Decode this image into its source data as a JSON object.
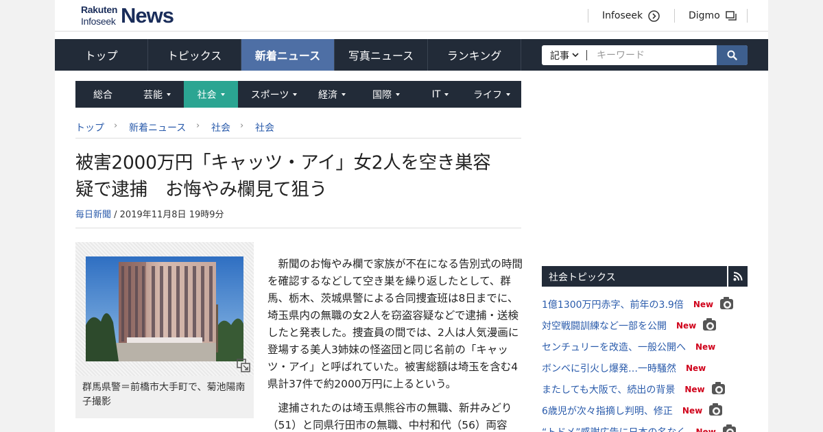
{
  "logo": {
    "line1": "Rakuten",
    "line2": "Infoseek",
    "brand": "News"
  },
  "toplinks": [
    {
      "label": "Infoseek",
      "icon": "arrow-circle-icon"
    },
    {
      "label": "Digmo",
      "icon": "window-icon"
    }
  ],
  "mainnav": {
    "tabs": [
      "トップ",
      "トピックス",
      "新着ニュース",
      "写真ニュース",
      "ランキング"
    ],
    "active": "新着ニュース"
  },
  "search": {
    "scope": "記事",
    "placeholder": "キーワード",
    "icon": "search-icon"
  },
  "categories": [
    {
      "label": "総合",
      "dropdown": false
    },
    {
      "label": "芸能",
      "dropdown": true
    },
    {
      "label": "社会",
      "dropdown": true,
      "active": true
    },
    {
      "label": "スポーツ",
      "dropdown": true
    },
    {
      "label": "経済",
      "dropdown": true
    },
    {
      "label": "国際",
      "dropdown": true
    },
    {
      "label": "IT",
      "dropdown": true
    },
    {
      "label": "ライフ",
      "dropdown": true
    }
  ],
  "breadcrumb": [
    "トップ",
    "新着ニュース",
    "社会",
    "社会"
  ],
  "article": {
    "title_line1": "被害2000万円「キャッツ・アイ」女2人を空き巣容",
    "title_line2": "疑で逮捕　お悔やみ欄見て狙う",
    "source": "毎日新聞",
    "date": " / 2019年11月8日 19時9分",
    "photo_caption": "群馬県警＝前橋市大手町で、菊池陽南子撮影",
    "paragraphs": [
      "新聞のお悔やみ欄で家族が不在になる告別式の時間を確認するなどして空き巣を繰り返したとして、群馬、栃木、茨城県警による合同捜査班は8日までに、埼玉県内の無職の女2人を窃盗容疑などで逮捕・送検したと発表した。捜査員の間では、2人は人気漫画に登場する美人3姉妹の怪盗団と同じ名前の「キャッツ・アイ」と呼ばれていた。被害総額は埼玉を含む4県計37件で約2000万円に上るという。",
      "逮捕されたのは埼玉県熊谷市の無職、新井みどり（51）と同県行田市の無職、中村和代（56）両容"
    ]
  },
  "sidebar": {
    "heading": "社会トピックス",
    "rss_icon": "rss-icon",
    "new_label": "New",
    "topics": [
      {
        "title": "1億1300万円赤字、前年の3.9倍",
        "camera": true
      },
      {
        "title": "対空戦闘訓練など一部を公開",
        "camera": true
      },
      {
        "title": "センチュリーを改造、一般公開へ",
        "camera": false
      },
      {
        "title": "ボンベに引火し爆発…一時騒然",
        "camera": false
      },
      {
        "title": "またしても大阪で、続出の背景",
        "camera": true
      },
      {
        "title": "6歳児が次々指摘し判明、修正",
        "camera": true
      },
      {
        "title": "“トドメ”感謝広告に日本の名なく",
        "camera": true
      }
    ]
  },
  "colors": {
    "nav_bg": "#222b38",
    "active_tab": "#4e6fa5",
    "active_category": "#2ba592",
    "link": "#2a5bab",
    "new_badge": "#d0021b"
  }
}
